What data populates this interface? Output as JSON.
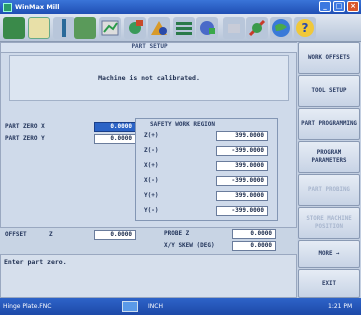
{
  "window": {
    "title": "WinMax Mill"
  },
  "panel": {
    "title": "PART SETUP"
  },
  "notice": "Machine is not calibrated.",
  "part_zero": {
    "x_label": "PART ZERO X",
    "x_value": "0.0000",
    "y_label": "PART ZERO Y",
    "y_value": "0.0000"
  },
  "safety": {
    "title": "SAFETY WORK REGION",
    "rows": [
      {
        "label": "Z(+)",
        "value": "399.0000"
      },
      {
        "label": "Z(-)",
        "value": "-399.0000"
      },
      {
        "label": "X(+)",
        "value": "399.0000"
      },
      {
        "label": "X(-)",
        "value": "-399.0000"
      },
      {
        "label": "Y(+)",
        "value": "399.0000"
      },
      {
        "label": "Y(-)",
        "value": "-399.0000"
      }
    ]
  },
  "offset": {
    "label": "OFFSET",
    "axis": "Z",
    "value": "0.0000"
  },
  "probe": {
    "label": "PROBE Z",
    "value": "0.0000"
  },
  "skew": {
    "label": "X/Y SKEW (DEG)",
    "value": "0.0000"
  },
  "message": "Enter part zero.",
  "side_buttons": [
    {
      "label": "WORK OFFSETS",
      "enabled": true
    },
    {
      "label": "TOOL SETUP",
      "enabled": true
    },
    {
      "label": "PART PROGRAMMING",
      "enabled": true
    },
    {
      "label": "PROGRAM PARAMETERS",
      "enabled": true
    },
    {
      "label": "PART PROBING",
      "enabled": false
    },
    {
      "label": "STORE MACHINE POSITION",
      "enabled": false
    },
    {
      "label": "MORE →",
      "enabled": true
    },
    {
      "label": "EXIT",
      "enabled": true
    }
  ],
  "status": {
    "file": "Hinge Plate.FNC",
    "units": "INCH",
    "time": "1:21 PM"
  },
  "colors": {
    "titlebar": "#2a5fcc",
    "active_field": "#2b63c6",
    "panel": "#cfdaea"
  },
  "toolbar_icons": [
    "open-file-icon",
    "graphics-icon",
    "tool-icon",
    "mdi-icon",
    "chart-icon",
    "tool-library-icon",
    "holder-icon",
    "list-icon",
    "setup-icon",
    "disabled-icon",
    "tools-icon",
    "globe-icon",
    "help-icon"
  ]
}
